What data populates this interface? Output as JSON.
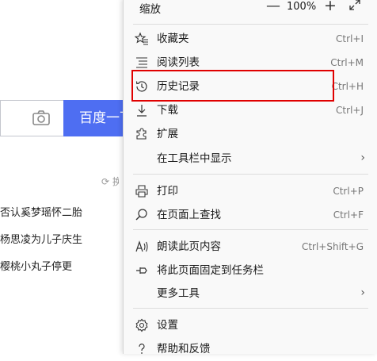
{
  "background": {
    "search_button": "百度一下",
    "refresh_label": "换一换",
    "news": [
      "否认奚梦瑶怀二胎",
      "杨思凌为儿子庆生",
      "樱桃小丸子停更"
    ]
  },
  "menu": {
    "zoom": {
      "label": "缩放",
      "minus": "—",
      "value": "100%",
      "plus": "+"
    },
    "items": [
      {
        "label": "收藏夹",
        "shortcut": "Ctrl+I"
      },
      {
        "label": "阅读列表",
        "shortcut": "Ctrl+M"
      },
      {
        "label": "历史记录",
        "shortcut": "Ctrl+H"
      },
      {
        "label": "下载",
        "shortcut": "Ctrl+J"
      },
      {
        "label": "扩展",
        "shortcut": ""
      },
      {
        "label": "在工具栏中显示",
        "shortcut": ""
      },
      {
        "label": "打印",
        "shortcut": "Ctrl+P"
      },
      {
        "label": "在页面上查找",
        "shortcut": "Ctrl+F"
      },
      {
        "label": "朗读此页内容",
        "shortcut": "Ctrl+Shift+G"
      },
      {
        "label": "将此页面固定到任务栏",
        "shortcut": ""
      },
      {
        "label": "更多工具",
        "shortcut": ""
      },
      {
        "label": "设置",
        "shortcut": ""
      },
      {
        "label": "帮助和反馈",
        "shortcut": ""
      }
    ],
    "chevron": "›"
  },
  "colors": {
    "highlight": "#e00000",
    "search_button": "#4e6ef2"
  }
}
